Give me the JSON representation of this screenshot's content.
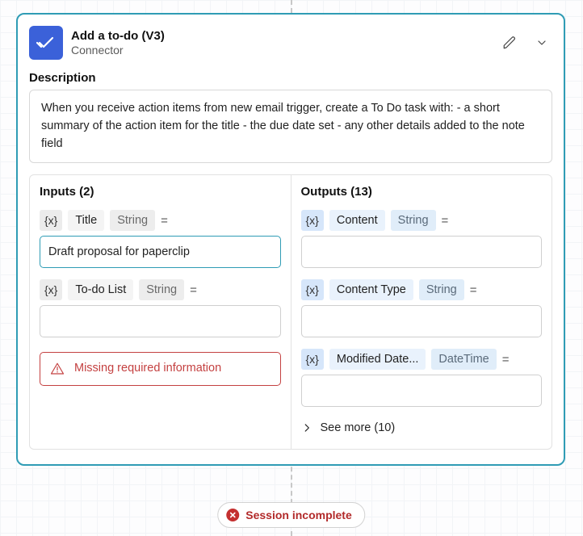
{
  "header": {
    "title": "Add a to-do (V3)",
    "subtitle": "Connector"
  },
  "description": {
    "label": "Description",
    "text": "When you receive action items from new email trigger, create a To Do task with: - a short summary of the action item for the title - the due date set - any other details added to the note field"
  },
  "inputs": {
    "heading": "Inputs (2)",
    "fields": [
      {
        "var": "{x}",
        "name": "Title",
        "type": "String",
        "value": "Draft proposal for paperclip"
      },
      {
        "var": "{x}",
        "name": "To-do List",
        "type": "String",
        "value": ""
      }
    ],
    "error": "Missing required information"
  },
  "outputs": {
    "heading": "Outputs (13)",
    "fields": [
      {
        "var": "{x}",
        "name": "Content",
        "type": "String",
        "value": ""
      },
      {
        "var": "{x}",
        "name": "Content Type",
        "type": "String",
        "value": ""
      },
      {
        "var": "{x}",
        "name": "Modified Date...",
        "type": "DateTime",
        "value": ""
      }
    ],
    "see_more": "See more (10)"
  },
  "session": {
    "status": "Session incomplete"
  },
  "glyphs": {
    "eq": "="
  }
}
